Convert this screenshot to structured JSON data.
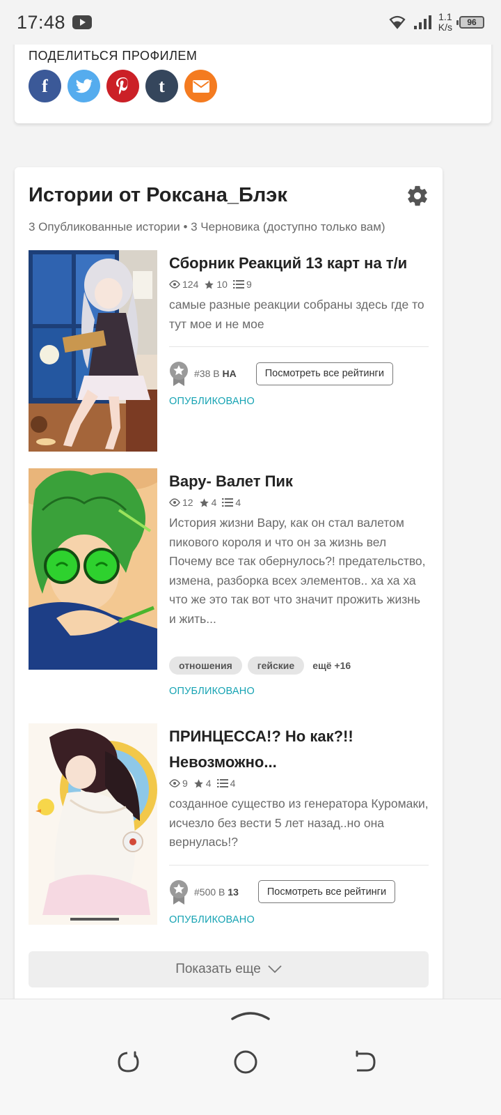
{
  "status_bar": {
    "time": "17:48",
    "net_speed_value": "1.1",
    "net_speed_unit": "K/s",
    "battery": "96"
  },
  "share": {
    "title": "ПОДЕЛИТЬСЯ ПРОФИЛЕМ",
    "buttons": [
      {
        "name": "facebook",
        "glyph": "f",
        "color": "#3b5998"
      },
      {
        "name": "twitter",
        "color": "#55acee"
      },
      {
        "name": "pinterest",
        "color": "#cb2027"
      },
      {
        "name": "tumblr",
        "glyph": "t",
        "color": "#35465c"
      },
      {
        "name": "email",
        "color": "#f47b20"
      }
    ]
  },
  "stories": {
    "title": "Истории от Роксана_Блэк",
    "subtitle": "3 Опубликованные истории • 3 Черновика (доступно только вам)",
    "items": [
      {
        "title": "Сборник Реакций 13 карт на т/и",
        "reads": "124",
        "votes": "10",
        "parts": "9",
        "description": "самые разные реакции собраны здесь где то тут мое и не мое",
        "rank_number": "#38",
        "rank_in": "В",
        "rank_tag": "НА",
        "ratings_button": "Посмотреть все рейтинги",
        "status": "ОПУБЛИКОВАНО"
      },
      {
        "title": "Вару- Валет Пик",
        "reads": "12",
        "votes": "4",
        "parts": "4",
        "description": "История жизни Вару, как он стал валетом пикового короля и что он за жизнь вел Почему все так обернулось?! предательство, измена, разборка всех элементов.. ха ха ха что же это так вот что значит прожить жизнь и жить...",
        "tags": [
          "отношения",
          "гейские"
        ],
        "tags_more": "ещё +16",
        "status": "ОПУБЛИКОВАНО"
      },
      {
        "title": "ПРИНЦЕССА!? Но как?!! Невозможно...",
        "reads": "9",
        "votes": "4",
        "parts": "4",
        "description": "созданное существо из генератора Куромаки, исчезло без вести 5 лет назад..но она вернулась!?",
        "rank_number": "#500",
        "rank_in": "В",
        "rank_tag": "13",
        "ratings_button": "Посмотреть все рейтинги",
        "status": "ОПУБЛИКОВАНО"
      }
    ],
    "show_more": "Показать еще"
  },
  "colors": {
    "accent_teal": "#16a3b3",
    "text_primary": "#222222",
    "text_secondary": "#6a6a6a"
  }
}
